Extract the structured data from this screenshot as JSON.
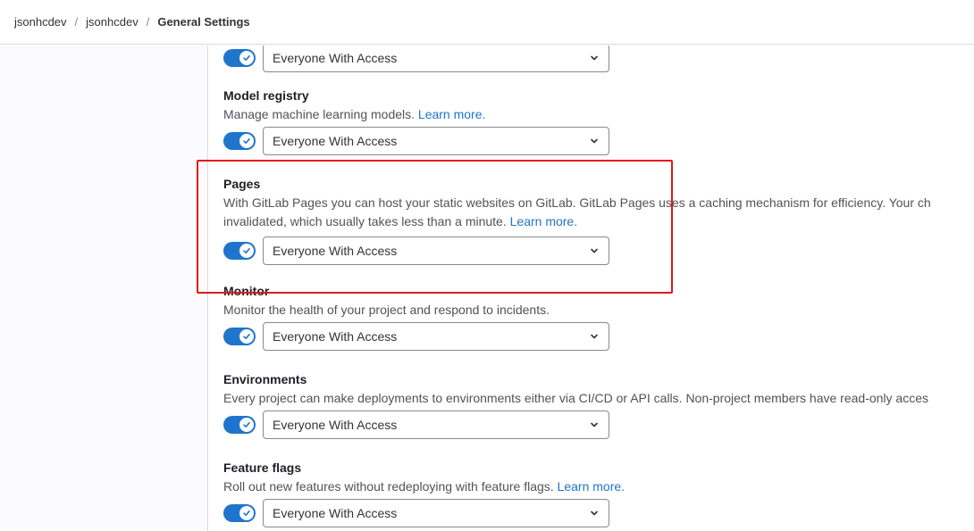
{
  "breadcrumb": {
    "items": [
      "jsonhcdev",
      "jsonhcdev"
    ],
    "current": "General Settings",
    "separator": "/"
  },
  "features": [
    {
      "title": "",
      "description": "",
      "learn_more": "",
      "select_value": "Everyone With Access",
      "enabled": true
    },
    {
      "title": "Model registry",
      "description": "Manage machine learning models.",
      "learn_more": "Learn more.",
      "select_value": "Everyone With Access",
      "enabled": true
    },
    {
      "title": "Pages",
      "description": "With GitLab Pages you can host your static websites on GitLab. GitLab Pages uses a caching mechanism for efficiency. Your ch",
      "description_line2": "invalidated, which usually takes less than a minute.",
      "learn_more": "Learn more.",
      "select_value": "Everyone With Access",
      "enabled": true
    },
    {
      "title": "Monitor",
      "description": "Monitor the health of your project and respond to incidents.",
      "learn_more": "",
      "select_value": "Everyone With Access",
      "enabled": true
    },
    {
      "title": "Environments",
      "description": "Every project can make deployments to environments either via CI/CD or API calls. Non-project members have read-only acces",
      "learn_more": "",
      "select_value": "Everyone With Access",
      "enabled": true
    },
    {
      "title": "Feature flags",
      "description": "Roll out new features without redeploying with feature flags.",
      "learn_more": "Learn more.",
      "select_value": "Everyone With Access",
      "enabled": true
    }
  ],
  "icons": {
    "toggle_check": "check-icon",
    "select_arrow": "chevron-down-icon"
  },
  "colors": {
    "accent": "#1f75cb",
    "highlight": "#e0191c"
  }
}
